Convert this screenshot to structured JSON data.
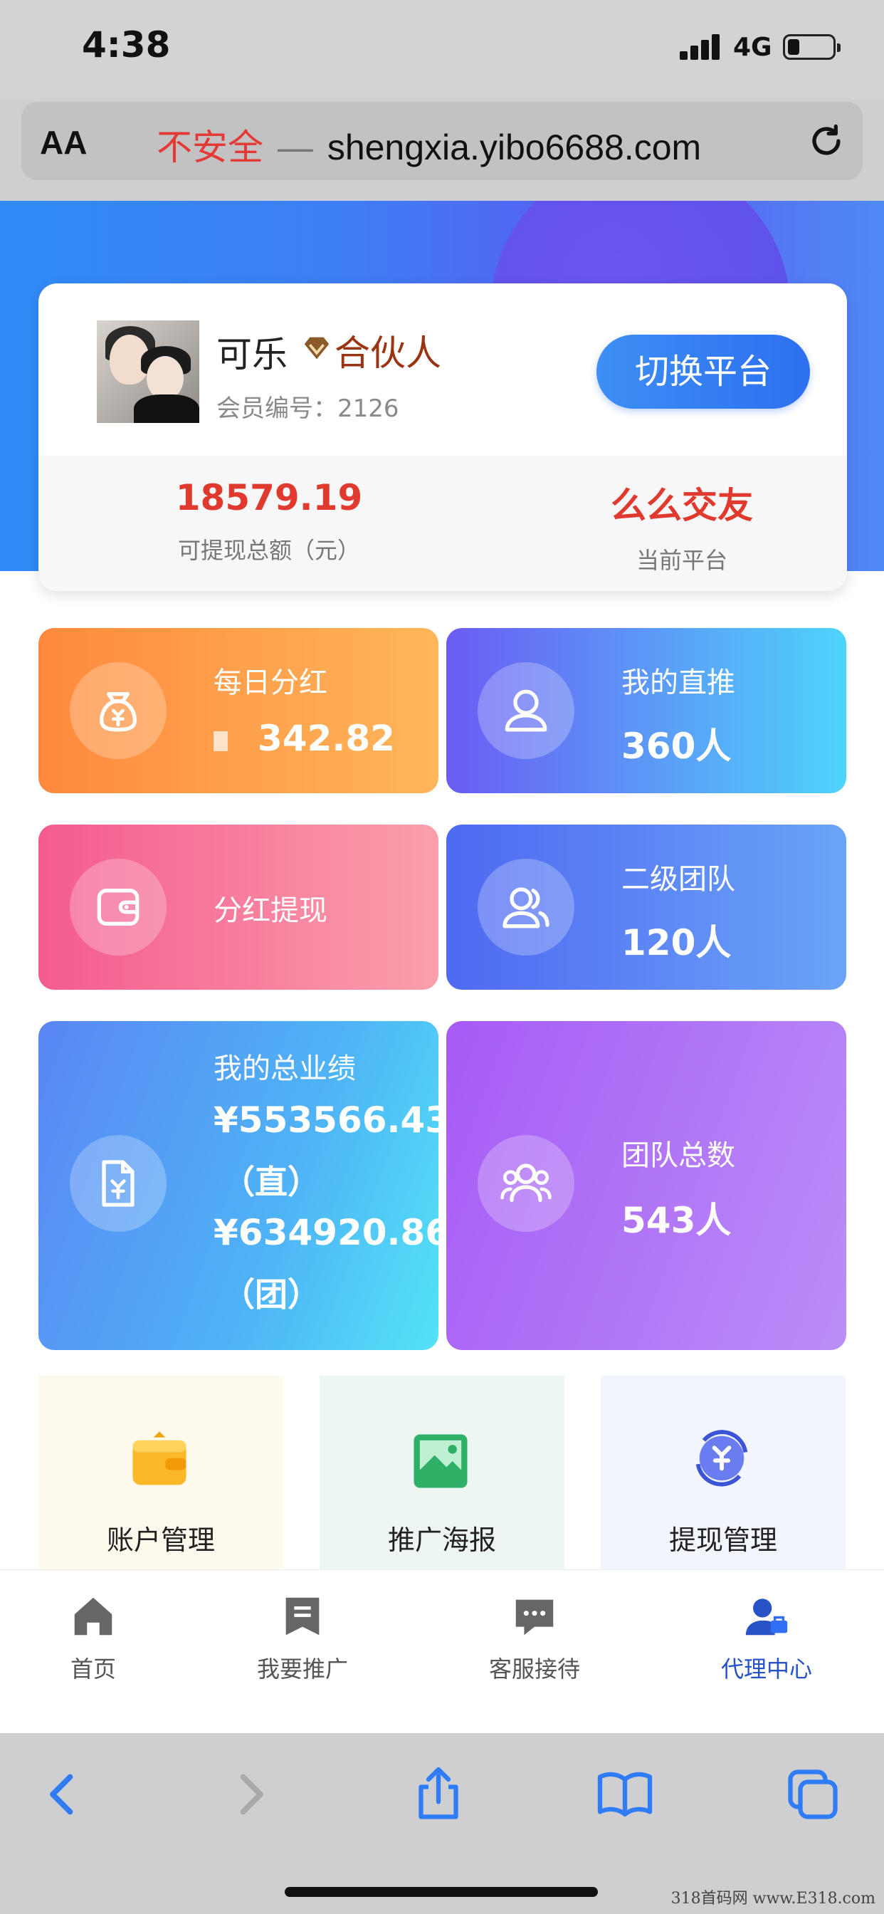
{
  "status_bar": {
    "time": "4:38",
    "network": "4G"
  },
  "url_bar": {
    "aa_label": "AA",
    "insecure_label": "不安全",
    "separator": "—",
    "domain": "shengxia.yibo6688.com"
  },
  "profile": {
    "name": "可乐",
    "role": "合伙人",
    "member_id": "会员编号：2126",
    "switch_button": "切换平台",
    "balance_value": "18579.19",
    "balance_label": "可提现总额（元）",
    "platform_value": "么么交友",
    "platform_label": "当前平台"
  },
  "tiles": {
    "daily_dividend": {
      "label": "每日分红",
      "value": "342.82"
    },
    "direct_referrals": {
      "label": "我的直推",
      "value": "360人"
    },
    "dividend_withdraw": {
      "label": "分红提现"
    },
    "second_team": {
      "label": "二级团队",
      "value": "120人"
    },
    "total_performance": {
      "label": "我的总业绩",
      "line1": "¥553566.43",
      "line2": "（直）",
      "line3": "¥634920.86",
      "line4": "（团）"
    },
    "team_total": {
      "label": "团队总数",
      "value": "543人"
    }
  },
  "quick_entries": [
    {
      "label": "账户管理",
      "icon": "wallet-icon"
    },
    {
      "label": "推广海报",
      "icon": "image-icon"
    },
    {
      "label": "提现管理",
      "icon": "yuan-refresh-icon"
    }
  ],
  "tab_bar": [
    {
      "label": "首页",
      "icon": "home-icon"
    },
    {
      "label": "我要推广",
      "icon": "bookmark-icon"
    },
    {
      "label": "客服接待",
      "icon": "chat-icon"
    },
    {
      "label": "代理中心",
      "icon": "agent-icon",
      "active": true
    }
  ],
  "watermark": "318首码网 www.E318.com",
  "colors": {
    "accent_red": "#e03a2f",
    "tab_active": "#2753c7"
  }
}
